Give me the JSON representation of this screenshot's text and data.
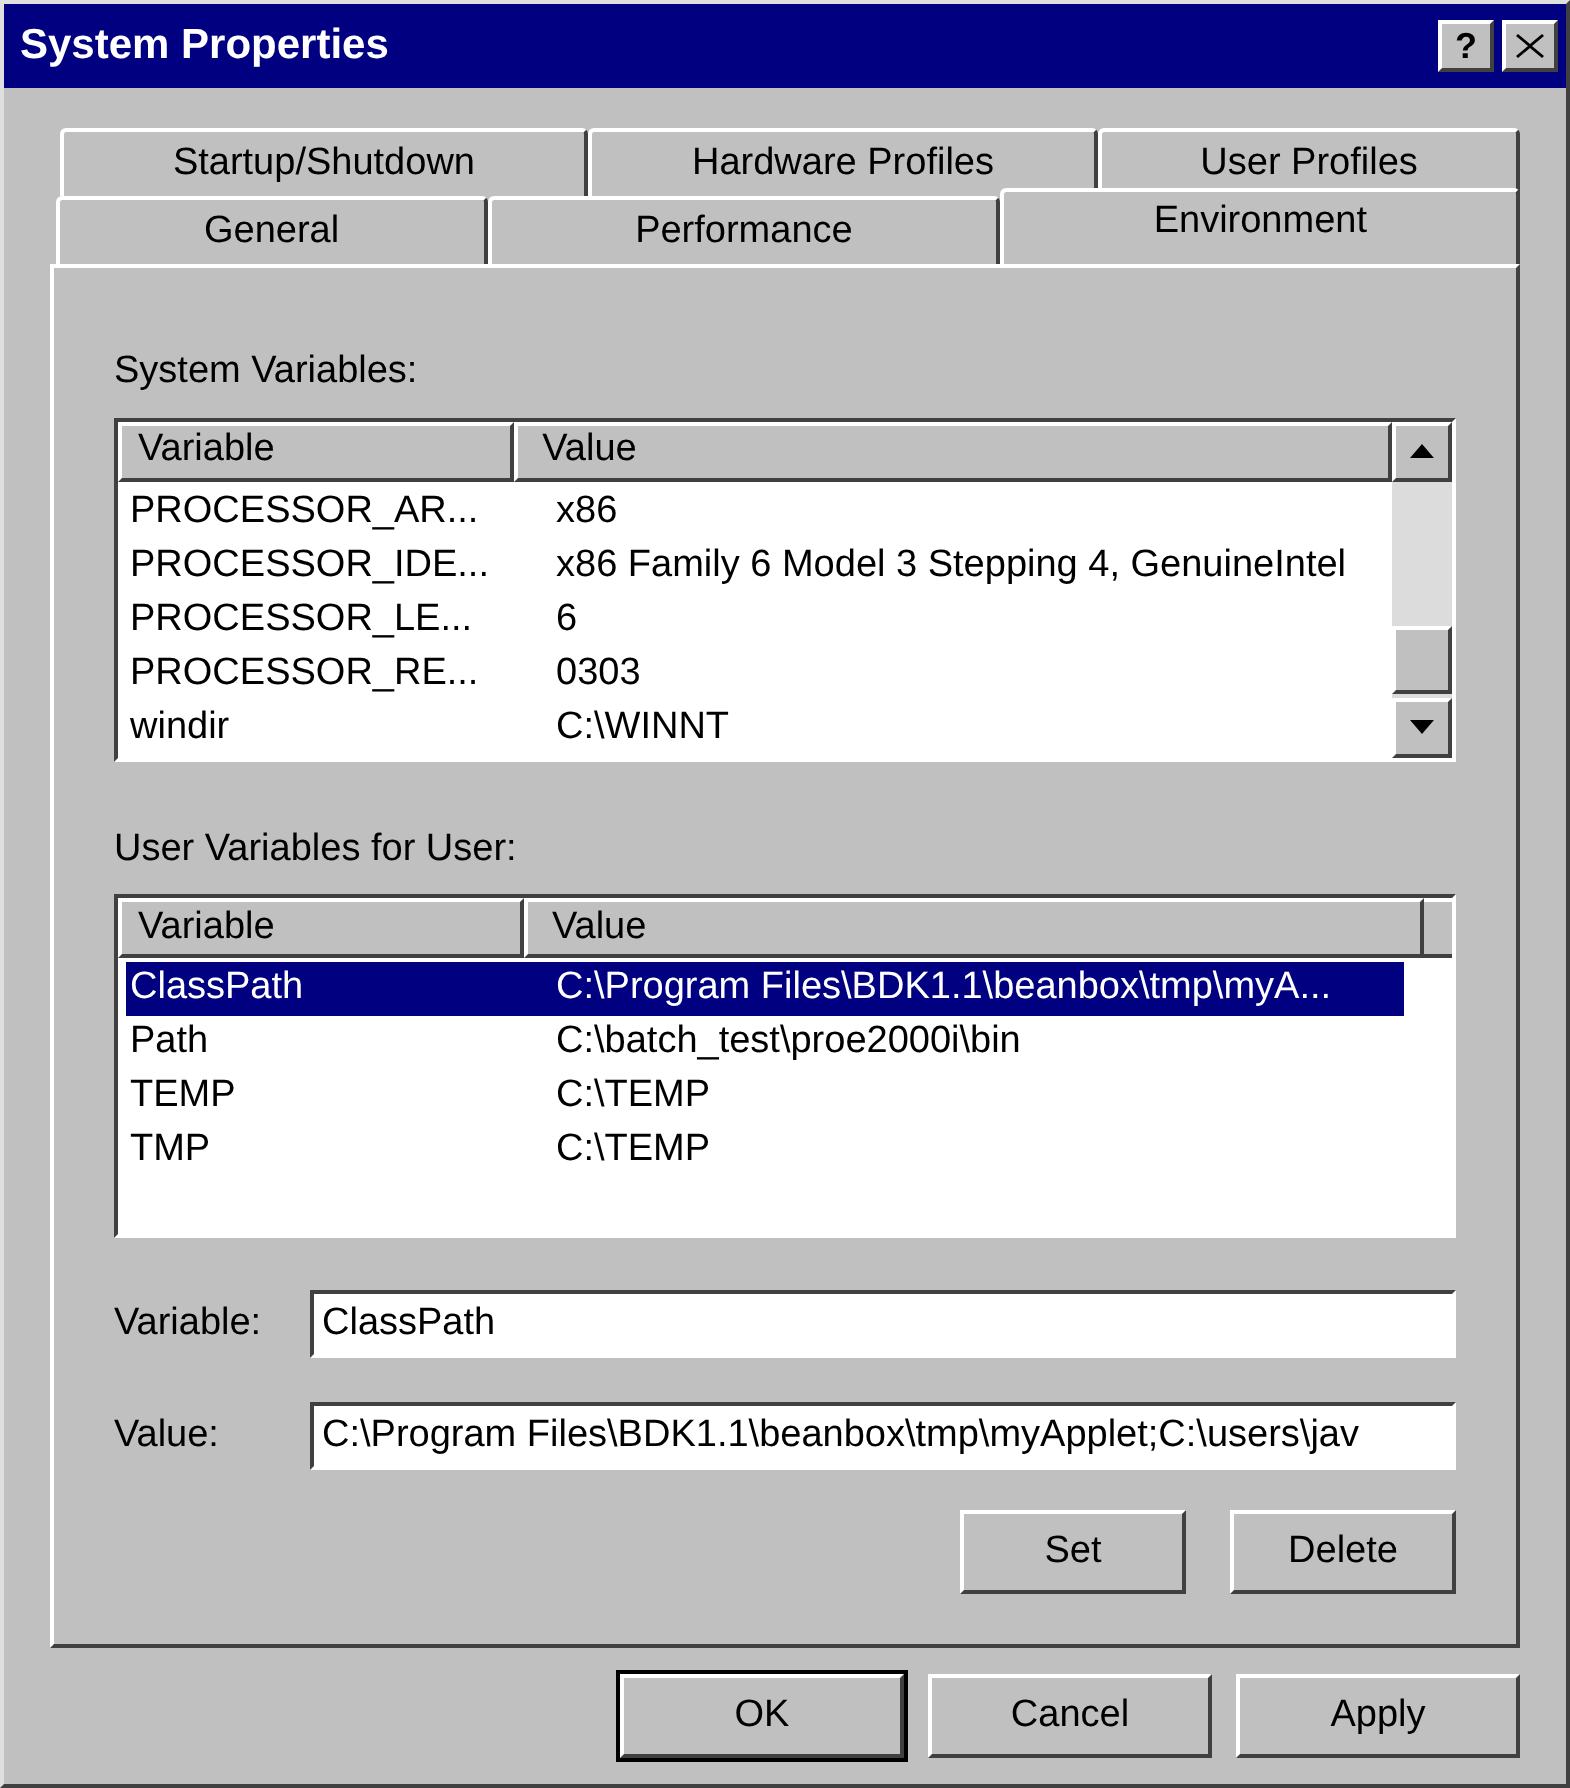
{
  "window": {
    "title": "System Properties",
    "help": "?"
  },
  "tab_rows": [
    {
      "tabs": [
        {
          "label": "Startup/Shutdown",
          "selected": false
        },
        {
          "label": "Hardware Profiles",
          "selected": false
        },
        {
          "label": "User Profiles",
          "selected": false
        }
      ]
    },
    {
      "tabs": [
        {
          "label": "General",
          "selected": false
        },
        {
          "label": "Performance",
          "selected": false
        },
        {
          "label": "Environment",
          "selected": true
        }
      ]
    }
  ],
  "system_variables": {
    "label": "System Variables:",
    "columns": [
      "Variable",
      "Value"
    ],
    "rows": [
      {
        "variable": "PROCESSOR_AR...",
        "value": "x86",
        "selected": false
      },
      {
        "variable": "PROCESSOR_IDE...",
        "value": "x86 Family 6 Model 3 Stepping 4, GenuineIntel",
        "selected": false
      },
      {
        "variable": "PROCESSOR_LE...",
        "value": "6",
        "selected": false
      },
      {
        "variable": "PROCESSOR_RE...",
        "value": "0303",
        "selected": false
      },
      {
        "variable": "windir",
        "value": "C:\\WINNT",
        "selected": false
      }
    ]
  },
  "user_variables": {
    "label": "User Variables for User:",
    "columns": [
      "Variable",
      "Value"
    ],
    "rows": [
      {
        "variable": "ClassPath",
        "value": "C:\\Program Files\\BDK1.1\\beanbox\\tmp\\myA...",
        "selected": true
      },
      {
        "variable": "Path",
        "value": "C:\\batch_test\\proe2000i\\bin",
        "selected": false
      },
      {
        "variable": "TEMP",
        "value": "C:\\TEMP",
        "selected": false
      },
      {
        "variable": "TMP",
        "value": "C:\\TEMP",
        "selected": false
      }
    ]
  },
  "fields": [
    {
      "label": "Variable:",
      "value": "ClassPath"
    },
    {
      "label": "Value:",
      "value": "C:\\Program Files\\BDK1.1\\beanbox\\tmp\\myApplet;C:\\users\\jav"
    }
  ],
  "edit_buttons": [
    "Set",
    "Delete"
  ],
  "dialog_buttons": [
    {
      "label": "OK",
      "default": true
    },
    {
      "label": "Cancel",
      "default": false
    },
    {
      "label": "Apply",
      "default": false
    }
  ]
}
